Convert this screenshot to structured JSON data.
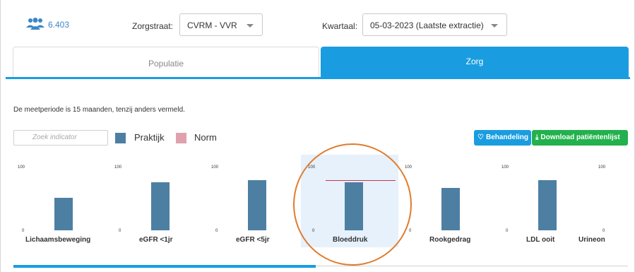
{
  "header": {
    "population_icon": "users-icon",
    "population_count": "6.403",
    "zorgstraat_label": "Zorgstraat:",
    "zorgstraat_value": "CVRM - VVR",
    "kwartaal_label": "Kwartaal:",
    "kwartaal_value": "05-03-2023 (Laatste extractie)"
  },
  "tabs": [
    {
      "label": "Populatie",
      "active": false
    },
    {
      "label": "Zorg",
      "active": true
    }
  ],
  "note": "De meetperiode is 15 maanden, tenzij anders vermeld.",
  "filters": {
    "search_placeholder": "Zoek indicator",
    "legend": [
      {
        "label": "Praktijk",
        "color": "#4d7fa3"
      },
      {
        "label": "Norm",
        "color": "#e0a1ae"
      }
    ],
    "buttons": {
      "behandeling": "Behandeling",
      "download": "Download patiëntenlijst"
    }
  },
  "chart_data": {
    "type": "bar",
    "ylim": [
      0,
      100
    ],
    "tick_labels": [
      "100",
      "0"
    ],
    "series": [
      {
        "name": "Praktijk",
        "color": "#4d7fa3"
      },
      {
        "name": "Norm",
        "color": "#c0394a"
      }
    ],
    "indicators": [
      {
        "label": "Lichaamsbeweging",
        "value": 55,
        "norm": null,
        "highlighted": false
      },
      {
        "label": "eGFR <1jr",
        "value": 82,
        "norm": null,
        "highlighted": false
      },
      {
        "label": "eGFR <5jr",
        "value": 86,
        "norm": null,
        "highlighted": false
      },
      {
        "label": "Bloeddruk",
        "value": 82,
        "norm": 85,
        "highlighted": true
      },
      {
        "label": "Rookgedrag",
        "value": 72,
        "norm": null,
        "highlighted": false
      },
      {
        "label": "LDL ooit",
        "value": 86,
        "norm": null,
        "highlighted": false
      },
      {
        "label": "Urineon",
        "value": null,
        "norm": null,
        "highlighted": false
      }
    ]
  },
  "colors": {
    "accent": "#1a9de0",
    "download_button": "#22b14c",
    "annotation": "#e07b2c"
  }
}
